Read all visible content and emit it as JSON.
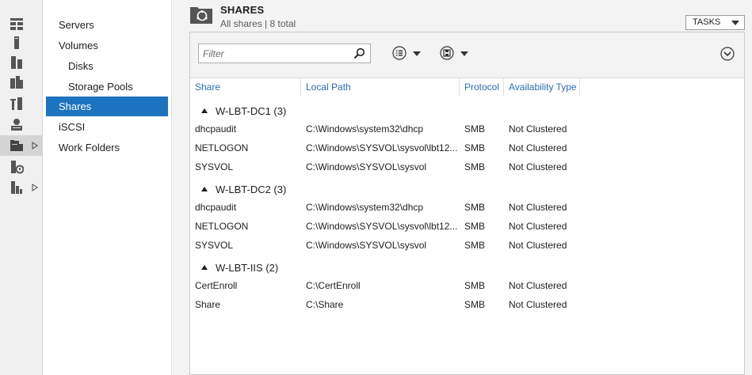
{
  "rail": {
    "items": [
      {
        "icon": "dashboard-icon",
        "selected": false,
        "has_arrow": false
      },
      {
        "icon": "local-server-icon",
        "selected": false,
        "has_arrow": false
      },
      {
        "icon": "all-servers-icon",
        "selected": false,
        "has_arrow": false
      },
      {
        "icon": "ad-ds-icon",
        "selected": false,
        "has_arrow": false
      },
      {
        "icon": "dns-icon",
        "selected": false,
        "has_arrow": false
      },
      {
        "icon": "dhcp-icon",
        "selected": false,
        "has_arrow": false
      },
      {
        "icon": "file-storage-services-icon",
        "selected": true,
        "has_arrow": true
      },
      {
        "icon": "iis-icon",
        "selected": false,
        "has_arrow": false
      },
      {
        "icon": "wsus-icon",
        "selected": false,
        "has_arrow": true
      }
    ]
  },
  "nav": {
    "items": [
      {
        "label": "Servers",
        "sub": false,
        "selected": false
      },
      {
        "label": "Volumes",
        "sub": false,
        "selected": false
      },
      {
        "label": "Disks",
        "sub": true,
        "selected": false
      },
      {
        "label": "Storage Pools",
        "sub": true,
        "selected": false
      },
      {
        "label": "Shares",
        "sub": false,
        "selected": true
      },
      {
        "label": "iSCSI",
        "sub": false,
        "selected": false
      },
      {
        "label": "Work Folders",
        "sub": false,
        "selected": false
      }
    ]
  },
  "header": {
    "title": "SHARES",
    "subtitle": "All shares | 8 total",
    "tasks_label": "TASKS"
  },
  "toolbar": {
    "filter_placeholder": "Filter",
    "list_icon": "list-view-icon",
    "save_icon": "save-query-icon",
    "expand_icon": "expand-collapse-icon"
  },
  "table": {
    "columns": [
      "Share",
      "Local Path",
      "Protocol",
      "Availability Type"
    ],
    "groups": [
      {
        "label": "W-LBT-DC1 (3)",
        "rows": [
          [
            "dhcpaudit",
            "C:\\Windows\\system32\\dhcp",
            "SMB",
            "Not Clustered"
          ],
          [
            "NETLOGON",
            "C:\\Windows\\SYSVOL\\sysvol\\lbt12....",
            "SMB",
            "Not Clustered"
          ],
          [
            "SYSVOL",
            "C:\\Windows\\SYSVOL\\sysvol",
            "SMB",
            "Not Clustered"
          ]
        ]
      },
      {
        "label": "W-LBT-DC2 (3)",
        "rows": [
          [
            "dhcpaudit",
            "C:\\Windows\\system32\\dhcp",
            "SMB",
            "Not Clustered"
          ],
          [
            "NETLOGON",
            "C:\\Windows\\SYSVOL\\sysvol\\lbt12....",
            "SMB",
            "Not Clustered"
          ],
          [
            "SYSVOL",
            "C:\\Windows\\SYSVOL\\sysvol",
            "SMB",
            "Not Clustered"
          ]
        ]
      },
      {
        "label": "W-LBT-IIS (2)",
        "rows": [
          [
            "CertEnroll",
            "C:\\CertEnroll",
            "SMB",
            "Not Clustered"
          ],
          [
            "Share",
            "C:\\Share",
            "SMB",
            "Not Clustered"
          ]
        ]
      }
    ]
  },
  "colors": {
    "accent": "#1e73be",
    "header_link": "#2a6db5",
    "rail_bg": "#f0f0f0",
    "content_bg": "#f3f3f3",
    "icon_gray": "#555555"
  }
}
